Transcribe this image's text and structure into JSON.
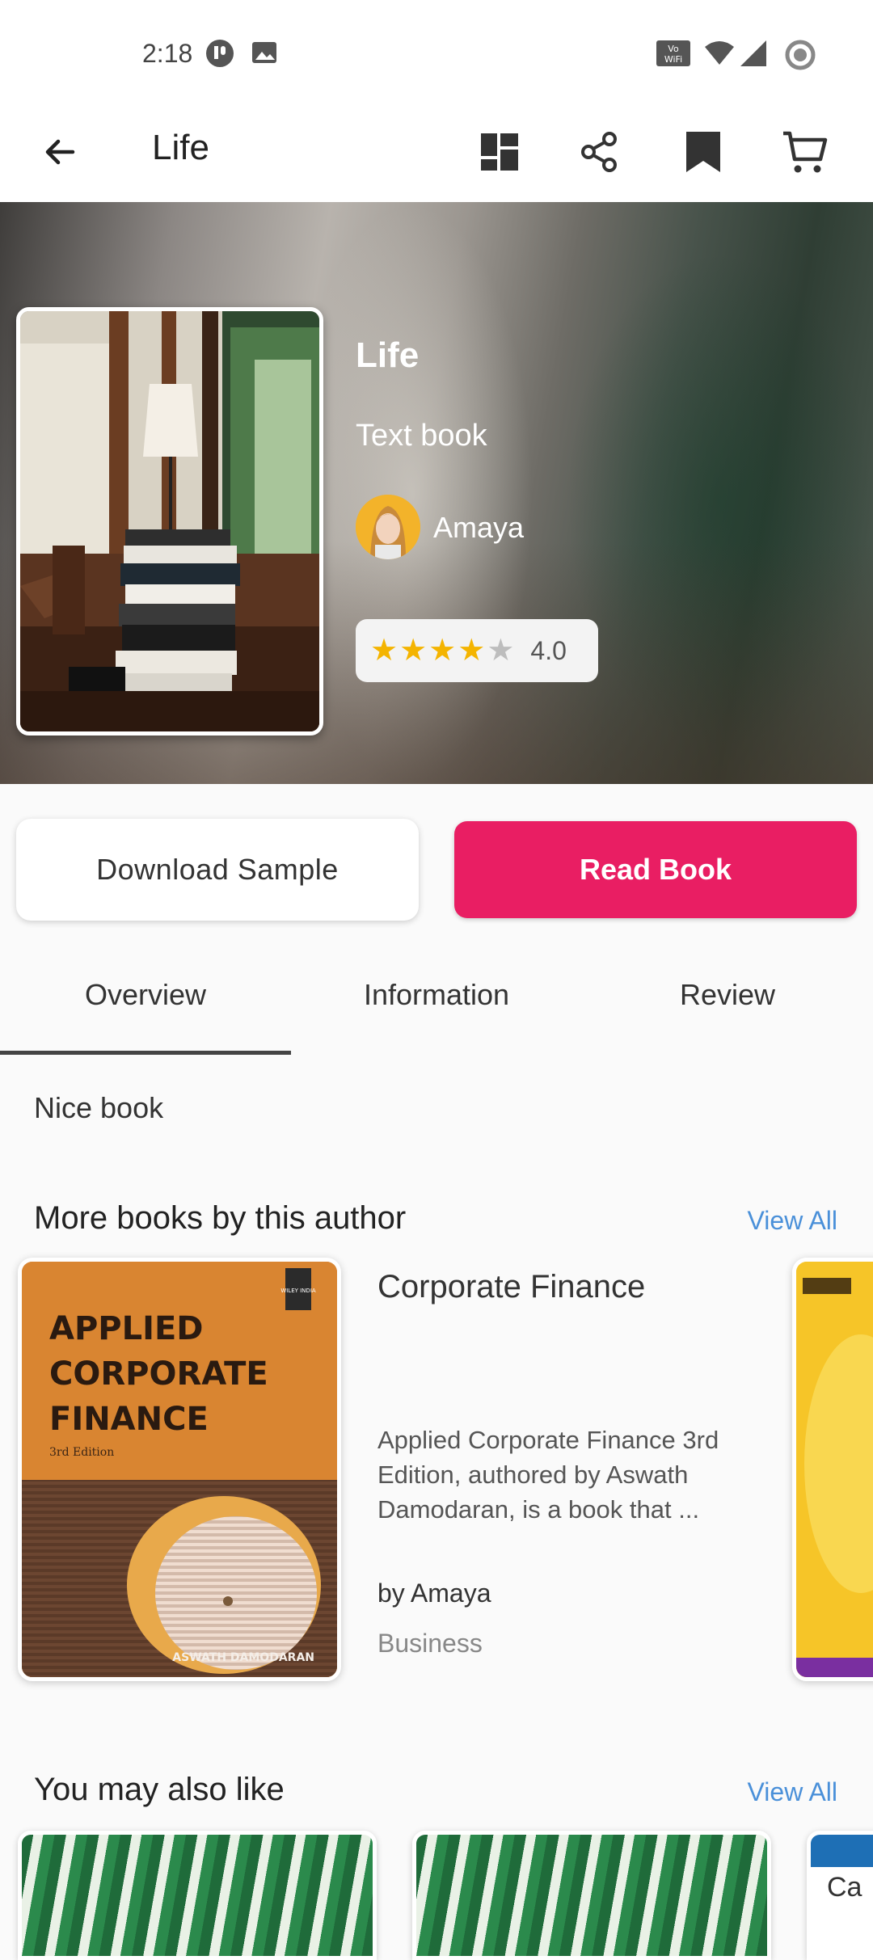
{
  "status_bar": {
    "time": "2:18"
  },
  "app_bar": {
    "title": "Life"
  },
  "book": {
    "title": "Life",
    "type": "Text book",
    "author": "Amaya",
    "rating": 4.0,
    "rating_text": "4.0",
    "rating_stars": 4
  },
  "actions": {
    "download_label": "Download Sample",
    "read_label": "Read Book"
  },
  "tabs": [
    {
      "label": "Overview",
      "active": true
    },
    {
      "label": "Information",
      "active": false
    },
    {
      "label": "Review",
      "active": false
    }
  ],
  "overview": {
    "text": "Nice book"
  },
  "more_by_author": {
    "title": "More books by this author",
    "view_all": "View All",
    "items": [
      {
        "title": "Corporate Finance",
        "cover_title_lines": [
          "APPLIED",
          "CORPORATE",
          "FINANCE"
        ],
        "cover_edition": "3rd Edition",
        "cover_author": "ASWATH DAMODARAN",
        "cover_publisher": "WILEY INDIA",
        "description": "Applied Corporate Finance 3rd Edition, authored by Aswath Damodaran, is a book that ...",
        "author": "by Amaya",
        "genre": "Business"
      }
    ]
  },
  "you_may_also_like": {
    "title": "You may also like",
    "view_all": "View All",
    "partial_label": "Ca"
  },
  "colors": {
    "accent": "#e91e63",
    "link": "#4a90d9",
    "star": "#f4b400"
  }
}
